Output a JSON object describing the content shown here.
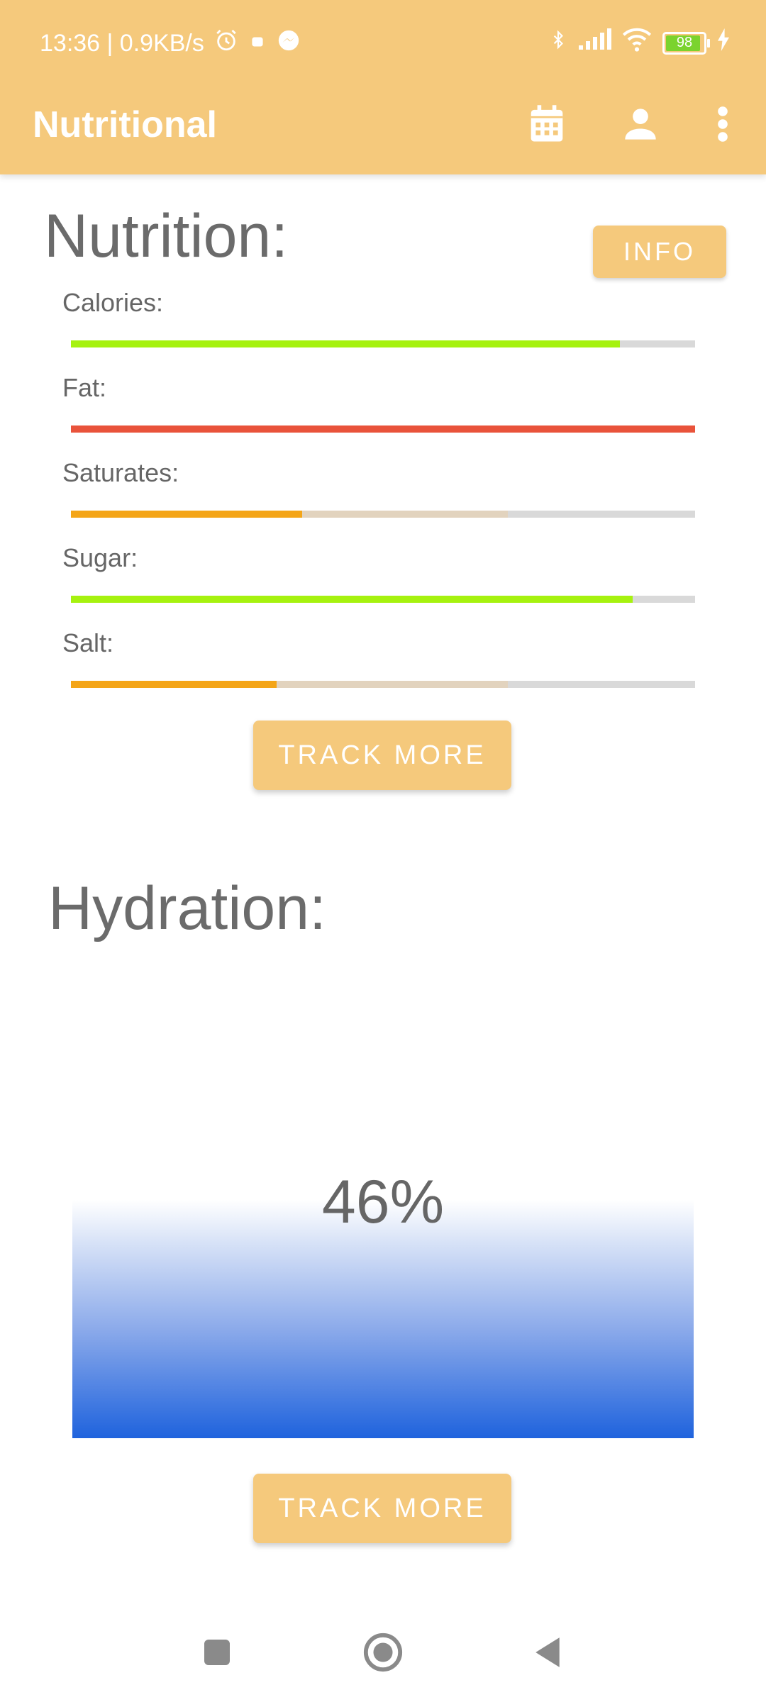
{
  "status_bar": {
    "time_speed": "13:36 | 0.9KB/s",
    "battery": "98"
  },
  "app_bar": {
    "title": "Nutritional",
    "icons": [
      "calendar-icon",
      "account-icon",
      "more-vert-icon"
    ]
  },
  "nutrition": {
    "heading": "Nutrition:",
    "info_label": "INFO",
    "items": [
      {
        "label": "Calories:",
        "progress": 0.88,
        "secondary": 0,
        "color": "#A6F20F"
      },
      {
        "label": "Fat:",
        "progress": 1.0,
        "secondary": 0,
        "color": "#E9533B"
      },
      {
        "label": "Saturates:",
        "progress": 0.37,
        "secondary": 0.7,
        "color": "#F4A517"
      },
      {
        "label": "Sugar:",
        "progress": 0.9,
        "secondary": 0,
        "color": "#A6F20F"
      },
      {
        "label": "Salt:",
        "progress": 0.33,
        "secondary": 0.7,
        "color": "#F4A517"
      }
    ],
    "track_label": "TRACK MORE"
  },
  "hydration": {
    "heading": "Hydration:",
    "percent_text": "46%",
    "level": 0.46,
    "track_label": "TRACK MORE"
  },
  "colors": {
    "accent": "#F5C97C",
    "water": "#1F63DD"
  },
  "nav": [
    "recents-icon",
    "home-icon",
    "back-icon"
  ]
}
